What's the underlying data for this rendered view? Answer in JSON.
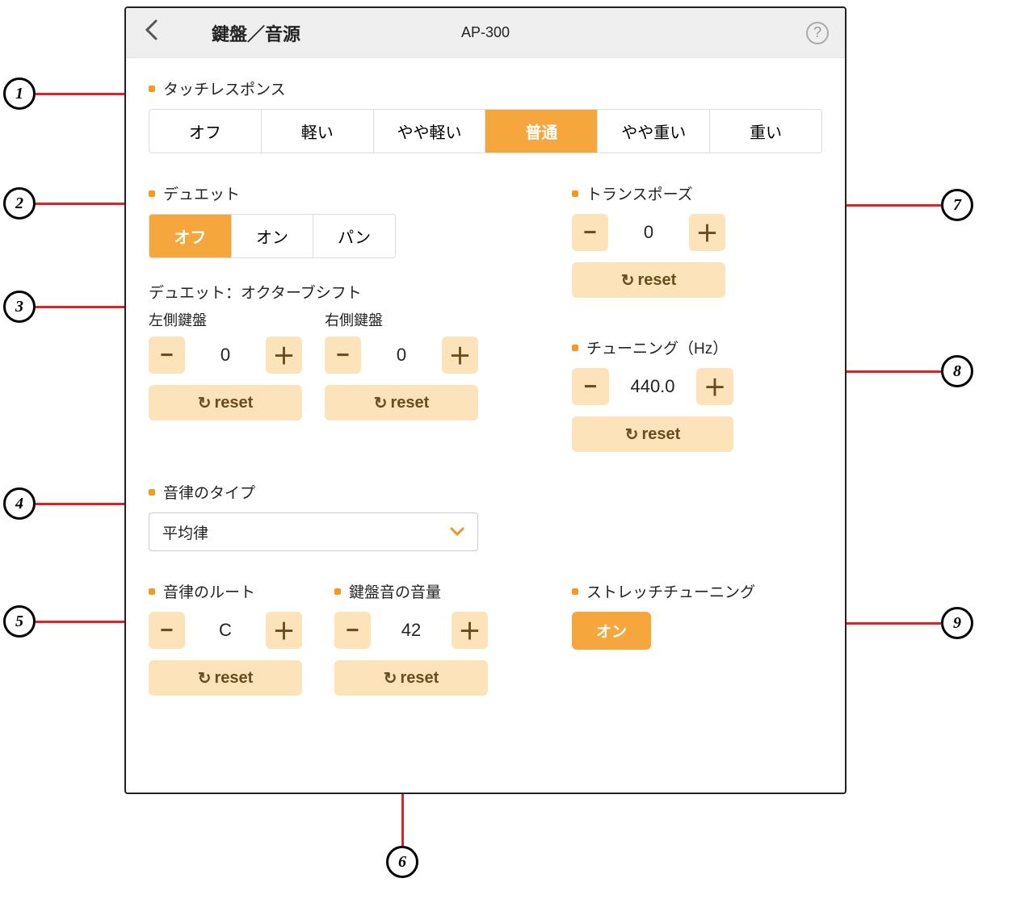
{
  "header": {
    "title": "鍵盤／音源",
    "device": "AP-300"
  },
  "touch_response": {
    "label": "タッチレスポンス",
    "options": [
      "オフ",
      "軽い",
      "やや軽い",
      "普通",
      "やや重い",
      "重い"
    ],
    "active_index": 3
  },
  "duet": {
    "label": "デュエット",
    "options": [
      "オフ",
      "オン",
      "パン"
    ],
    "active_index": 0
  },
  "octave_shift": {
    "label": "デュエット：オクターブシフト",
    "left_label": "左側鍵盤",
    "right_label": "右側鍵盤",
    "left_value": "0",
    "right_value": "0",
    "reset": "reset"
  },
  "temperament": {
    "label": "音律のタイプ",
    "value": "平均律"
  },
  "temperament_root": {
    "label": "音律のルート",
    "value": "C",
    "reset": "reset"
  },
  "keyboard_volume": {
    "label": "鍵盤音の音量",
    "value": "42",
    "reset": "reset"
  },
  "transpose": {
    "label": "トランスポーズ",
    "value": "0",
    "reset": "reset"
  },
  "tuning": {
    "label": "チューニング（Hz）",
    "value": "440.0",
    "reset": "reset"
  },
  "stretch_tuning": {
    "label": "ストレッチチューニング",
    "value": "オン"
  },
  "callouts": {
    "1": "1",
    "2": "2",
    "3": "3",
    "4": "4",
    "5": "5",
    "6": "6",
    "7": "7",
    "8": "8",
    "9": "9"
  }
}
